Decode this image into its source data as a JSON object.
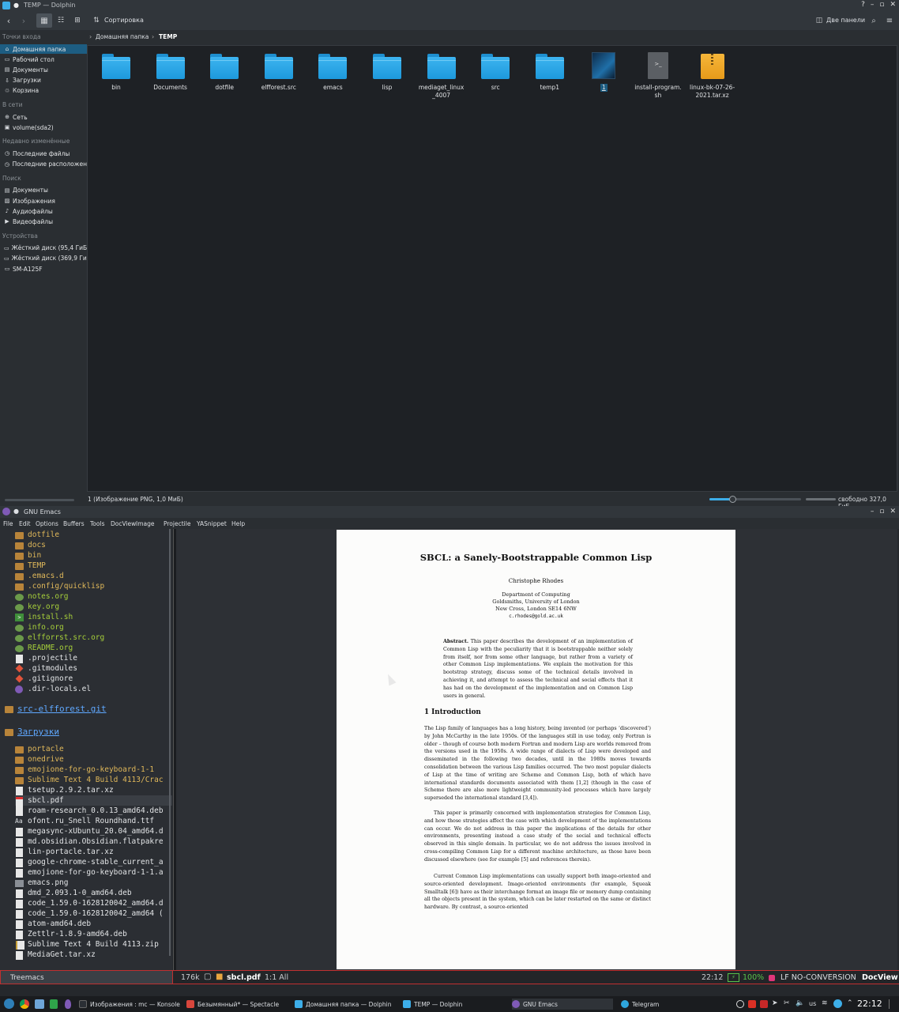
{
  "dolphin": {
    "title": "TEMP — Dolphin",
    "toolbar": {
      "sort_label": "Сортировка",
      "split_label": "Две панели"
    },
    "breadcrumb": {
      "home": "Домашняя папка",
      "current": "TEMP"
    },
    "sidebar": {
      "sections": [
        {
          "heading": "Точки входа",
          "items": [
            "Домашняя папка",
            "Рабочий стол",
            "Документы",
            "Загрузки",
            "Корзина"
          ]
        },
        {
          "heading": "В сети",
          "items": [
            "Сеть",
            "volume(sda2)"
          ]
        },
        {
          "heading": "Недавно изменённые",
          "items": [
            "Последние файлы",
            "Последние расположен"
          ]
        },
        {
          "heading": "Поиск",
          "items": [
            "Документы",
            "Изображения",
            "Аудиофайлы",
            "Видеофайлы"
          ]
        },
        {
          "heading": "Устройства",
          "items": [
            "Жёсткий диск (95,4 ГиБ)",
            "Жёсткий диск (369,9 ГиБ",
            "SM-A125F"
          ]
        }
      ]
    },
    "files": [
      {
        "name": "bin",
        "type": "folder"
      },
      {
        "name": "Documents",
        "type": "folder"
      },
      {
        "name": "dotfile",
        "type": "folder"
      },
      {
        "name": "elfforest.src",
        "type": "folder"
      },
      {
        "name": "emacs",
        "type": "folder"
      },
      {
        "name": "lisp",
        "type": "folder"
      },
      {
        "name": "mediaget_linux_4007",
        "type": "folder"
      },
      {
        "name": "src",
        "type": "folder"
      },
      {
        "name": "temp1",
        "type": "folder"
      },
      {
        "name": "1",
        "type": "image"
      },
      {
        "name": "install-program.sh",
        "type": "script"
      },
      {
        "name": "linux-bk-07-26-2021.tar.xz",
        "type": "archive"
      }
    ],
    "status": {
      "selection": "1 (Изображение PNG, 1,0 МиБ)",
      "free": "свободно 327,0 ГиБ"
    }
  },
  "emacs": {
    "title": "GNU Emacs",
    "menu": [
      "File",
      "Edit",
      "Options",
      "Buffers",
      "Tools",
      "DocView",
      "Image",
      "Projectile",
      "YASnippet",
      "Help"
    ],
    "treemacs": {
      "top_items": [
        {
          "name": "dotfile",
          "icon": "fold"
        },
        {
          "name": "docs",
          "icon": "fold"
        },
        {
          "name": "bin",
          "icon": "fold"
        },
        {
          "name": "TEMP",
          "icon": "fold"
        },
        {
          "name": ".emacs.d",
          "icon": "fold"
        },
        {
          "name": ".config/quicklisp",
          "icon": "fold"
        },
        {
          "name": "notes.org",
          "icon": "org"
        },
        {
          "name": "key.org",
          "icon": "org"
        },
        {
          "name": "install.sh",
          "icon": "sh"
        },
        {
          "name": "info.org",
          "icon": "org"
        },
        {
          "name": "elfforrst.src.org",
          "icon": "org"
        },
        {
          "name": "README.org",
          "icon": "org"
        },
        {
          "name": ".projectile",
          "icon": "file"
        },
        {
          "name": ".gitmodules",
          "icon": "git"
        },
        {
          "name": ".gitignore",
          "icon": "git"
        },
        {
          "name": ".dir-locals.el",
          "icon": "el"
        }
      ],
      "project1": "src-elfforest.git",
      "project2": "Загрузки",
      "downloads": [
        {
          "name": "portacle",
          "icon": "fold"
        },
        {
          "name": "onedrive",
          "icon": "fold"
        },
        {
          "name": "emojione-for-go-keyboard-1-1",
          "icon": "fold"
        },
        {
          "name": "Sublime Text 4 Build 4113/Crac",
          "icon": "fold"
        },
        {
          "name": "tsetup.2.9.2.tar.xz",
          "icon": "file"
        },
        {
          "name": "sbcl.pdf",
          "icon": "pdf"
        },
        {
          "name": "roam-research_0.0.13_amd64.deb",
          "icon": "file"
        },
        {
          "name": "ofont.ru_Snell Roundhand.ttf",
          "icon": "font"
        },
        {
          "name": "megasync-xUbuntu_20.04_amd64.d",
          "icon": "file"
        },
        {
          "name": "md.obsidian.Obsidian.flatpakre",
          "icon": "file"
        },
        {
          "name": "lin-portacle.tar.xz",
          "icon": "file"
        },
        {
          "name": "google-chrome-stable_current_a",
          "icon": "file"
        },
        {
          "name": "emojione-for-go-keyboard-1-1.a",
          "icon": "file"
        },
        {
          "name": "emacs.png",
          "icon": "img"
        },
        {
          "name": "dmd_2.093.1-0_amd64.deb",
          "icon": "file"
        },
        {
          "name": "code_1.59.0-1628120042_amd64.d",
          "icon": "file"
        },
        {
          "name": "code_1.59.0-1628120042_amd64 (",
          "icon": "file"
        },
        {
          "name": "atom-amd64.deb",
          "icon": "file"
        },
        {
          "name": "Zettlr-1.8.9-amd64.deb",
          "icon": "file"
        },
        {
          "name": "Sublime Text 4 Build 4113.zip",
          "icon": "zip"
        },
        {
          "name": "MediaGet.tar.xz",
          "icon": "file"
        }
      ],
      "modeline": "Treemacs"
    },
    "pdf": {
      "title": "SBCL: a Sanely-Bootstrappable Common Lisp",
      "author": "Christophe Rhodes",
      "affil": [
        "Department of Computing",
        "Goldsmiths, University of London",
        "New Cross, London SE14 6NW"
      ],
      "email": "c.rhodes@gold.ac.uk",
      "abstract_label": "Abstract.",
      "abstract": "This paper describes the development of an implementation of Common Lisp with the peculiarity that it is bootstrappable neither solely from itself, nor from some other language, but rather from a variety of other Common Lisp implementations. We explain the motivation for this bootstrap strategy, discuss some of the technical details involved in achieving it, and attempt to assess the technical and social effects that it has had on the development of the implementation and on Common Lisp users in general.",
      "section": "1   Introduction",
      "para1": "The Lisp family of languages has a long history, being invented (or perhaps ‘discovered’) by John McCarthy in the late 1950s. Of the languages still in use today, only Fortran is older – though of course both modern Fortran and modern Lisp are worlds removed from the versions used in the 1950s. A wide range of dialects of Lisp were developed and disseminated in the following two decades, until in the 1980s moves towards consolidation between the various Lisp families occurred. The two most popular dialects of Lisp at the time of writing are Scheme and Common Lisp, both of which have international standards documents associated with them [1,2] (though in the case of Scheme there are also more lightweight community-led processes which have largely superseded the international standard [3,4]).",
      "para2": "This paper is primarily concerned with implementation strategies for Common Lisp, and how those strategies affect the case with which development of the implementations can occur. We do not address in this paper the implications of the details for other environments, presenting instead a case study of the social and technical effects observed in this single domain. In particular, we do not address the issues involved in cross-compiling Common Lisp for a different machine architecture, as those have been discussed elsewhere (see for example [5] and references therein).",
      "para3": "Current Common Lisp implementations can usually support both image-oriented and source-oriented development. Image-oriented environments (for example, Squeak Smalltalk [6]) have as their interchange format an image file or memory dump containing all the objects present in the system, which can be later restarted on the same or distinct hardware. By contrast, a source-oriented"
    },
    "modeline": {
      "size": "176k",
      "buffer": "sbcl.pdf",
      "pos": "1:1 All",
      "time": "22:12",
      "battery": "100%",
      "coding": "LF NO-CONVERSION",
      "mode": "DocView"
    }
  },
  "taskbar": {
    "tasks": [
      "Изображения : mc — Konsole",
      "Безымянный* — Spectacle",
      "Домашняя папка — Dolphin",
      "TEMP — Dolphin",
      "GNU Emacs",
      "Telegram"
    ],
    "layout": "us",
    "clock": "22:12"
  },
  "colors": {
    "accent": "#3daee9",
    "selection": "#1d5d82",
    "treemacs_folder": "#b8843a",
    "treemacs_text": "#e0b85a",
    "org_text": "#a6cf3a",
    "project_link": "#5fa8ff",
    "modeline_border": "#c03030"
  }
}
